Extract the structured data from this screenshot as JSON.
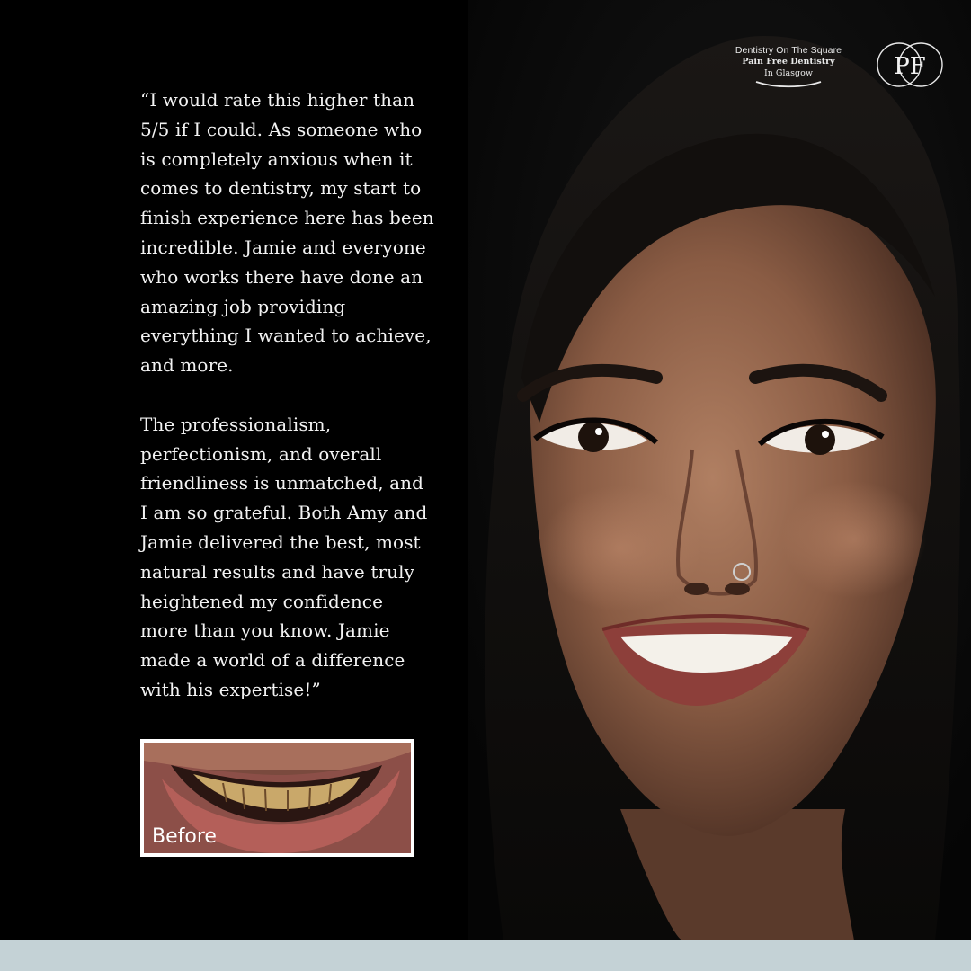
{
  "testimonial": {
    "paragraph_1": "“I would rate this higher than\n5/5 if I could. As someone who\nis completely anxious when it\ncomes to dentistry, my start to\nfinish experience here has been\nincredible. Jamie and everyone\nwho works there have done an\namazing job providing\neverything I wanted to achieve,\nand more.",
    "paragraph_2": "The professionalism,\nperfectionism, and overall\nfriendliness is unmatched, and\nI am so grateful. Both Amy and\nJamie delivered the best, most\nnatural results and have truly\nheightened my confidence\nmore than you know. Jamie\nmade a world of a difference\nwith his expertise!”"
  },
  "before_photo": {
    "label": "Before"
  },
  "brand": {
    "name": "Dentistry On The Square",
    "tagline": "Pain Free Dentistry",
    "location": "In Glasgow",
    "logo_letters": "PF"
  },
  "colors": {
    "background": "#000000",
    "footer_band": "#c4d2d6",
    "text": "#f2f2f2"
  }
}
